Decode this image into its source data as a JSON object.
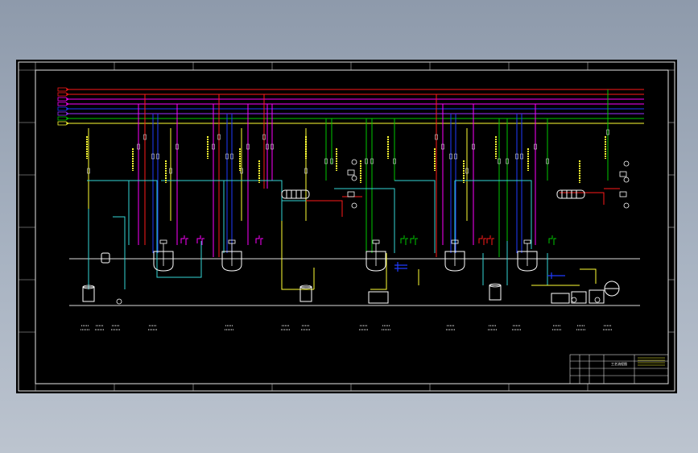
{
  "title_block": {
    "drawing_title": "工艺流程图"
  },
  "colors": {
    "canvas": "#000000",
    "frame": "#ffffff",
    "steam": "#ff1a1a",
    "cooling_water": "#ff00ff",
    "brine": "#1f3bff",
    "vacuum": "#00c800",
    "water": "#ffff33",
    "process": "#33d6d6",
    "air": "#9b30ff"
  },
  "header_rows": 8,
  "equipment_count": 16
}
